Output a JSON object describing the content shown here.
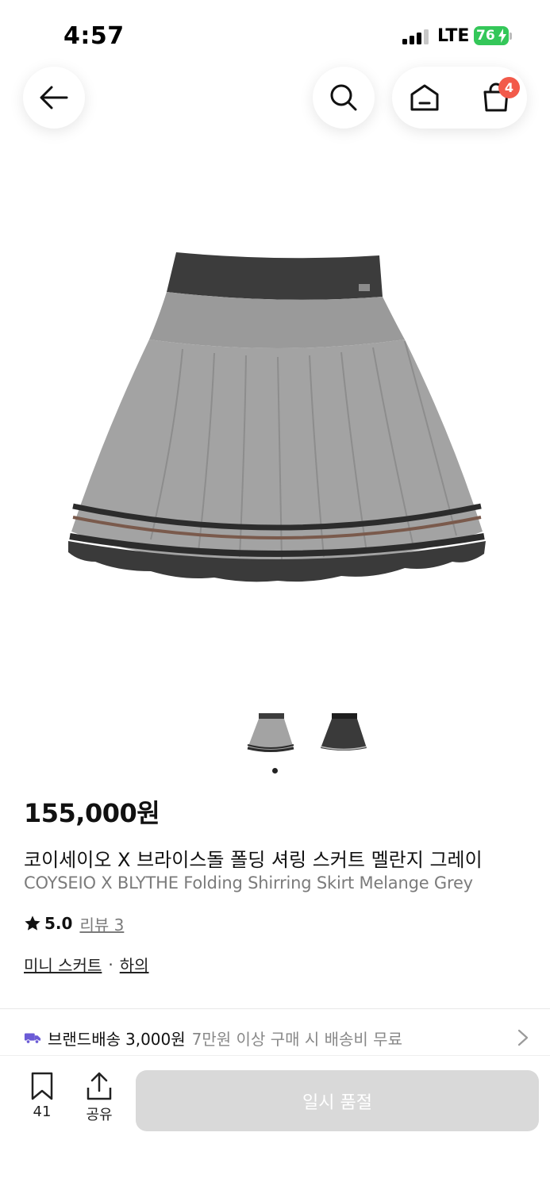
{
  "status_bar": {
    "time": "4:57",
    "network": "LTE",
    "battery": "76"
  },
  "nav": {
    "back_icon": "arrow-left-icon",
    "search_icon": "search-icon",
    "home_icon": "home-icon",
    "cart_icon": "shopping-bag-icon",
    "cart_count": "4"
  },
  "colors": {
    "badge": "#f25a4a",
    "battery": "#34c759",
    "disabled_button": "#d9d9d9",
    "delivery_icon": "#6b5bd6"
  },
  "gallery": {
    "image_count": 2,
    "current_index": 0
  },
  "product": {
    "price": "155,000원",
    "name_ko": "코이세이오 X 브라이스돌 폴딩 셔링 스커트 멜란지 그레이",
    "name_en": "COYSEIO X BLYTHE Folding Shirring Skirt Melange Grey",
    "rating": "5.0",
    "review_label": "리뷰 3",
    "category": "미니 스커트",
    "category_sep": "·",
    "parent_category": "하의"
  },
  "shipping": {
    "label": "브랜드배송",
    "fee": "3,000원",
    "note": "7만원 이상 구매 시 배송비 무료"
  },
  "bottom": {
    "bookmark_count": "41",
    "share_label": "공유",
    "buy_button": "일시 품절"
  }
}
